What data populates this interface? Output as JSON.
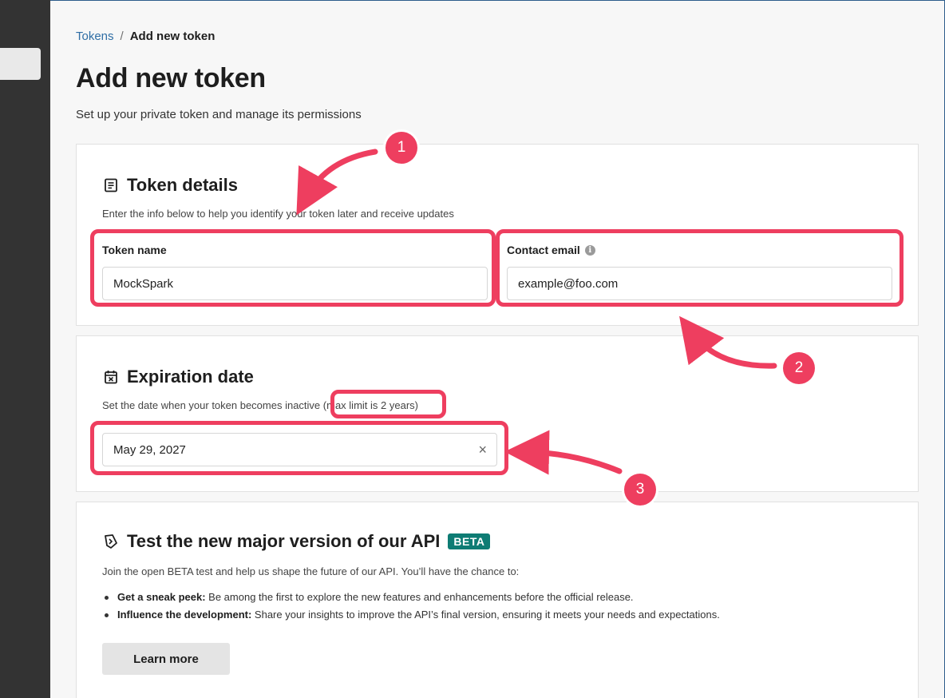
{
  "breadcrumb": {
    "parent": "Tokens",
    "separator": "/",
    "current": "Add new token"
  },
  "page": {
    "title": "Add new token",
    "subtitle": "Set up your private token and manage its permissions"
  },
  "token_details": {
    "icon": "document-list-icon",
    "title": "Token details",
    "description": "Enter the info below to help you identify your token later and receive updates",
    "token_name": {
      "label": "Token name",
      "value": "MockSpark"
    },
    "contact_email": {
      "label": "Contact email",
      "value": "example@foo.com",
      "info_icon": "i"
    }
  },
  "expiration": {
    "icon": "calendar-x-icon",
    "title": "Expiration date",
    "description": "Set the date when your token becomes inactive",
    "limit_note": "(max limit is 2 years)",
    "date_value": "May 29, 2027",
    "clear_symbol": "×"
  },
  "beta": {
    "icon": "flask-icon",
    "title": "Test the new major version of our API",
    "badge": "BETA",
    "intro": "Join the open BETA test and help us shape the future of our API. You’ll have the chance to:",
    "bullets": [
      {
        "bold": "Get a sneak peek:",
        "text": " Be among the first to explore the new features and enhancements before the official release."
      },
      {
        "bold": "Influence the development:",
        "text": " Share your insights to improve the API’s final version, ensuring it meets your needs and expectations."
      }
    ],
    "button": "Learn more"
  },
  "annotations": {
    "color": "#ee3e5f",
    "markers": [
      "1",
      "2",
      "3"
    ]
  },
  "colors": {
    "link": "#2f6ea5",
    "badge": "#0e7c74",
    "sidebar": "#333333"
  }
}
